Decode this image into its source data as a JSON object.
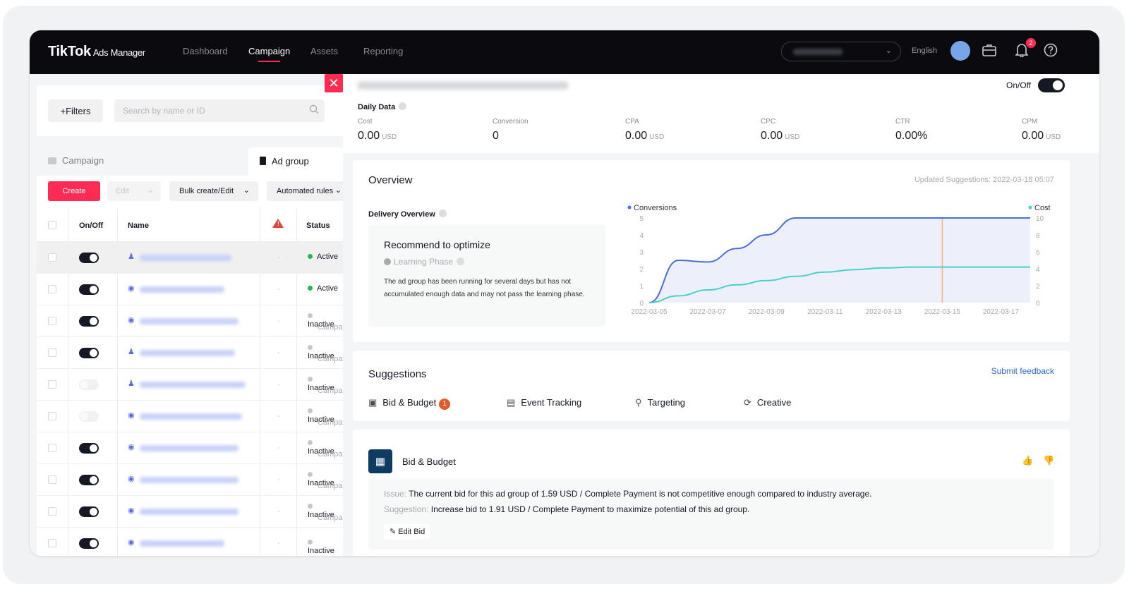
{
  "topbar": {
    "brand": "TikTok",
    "brand_sub": "Ads Manager",
    "nav": [
      "Dashboard",
      "Campaign",
      "Assets",
      "Reporting"
    ],
    "active_nav": "Campaign",
    "language": "English",
    "notification_count": "2"
  },
  "left": {
    "filters_label": "+Filters",
    "search_placeholder": "Search by name or ID",
    "tab_campaign": "Campaign",
    "tab_adgroup": "Ad group",
    "create_label": "Create",
    "edit_label": "Edit",
    "bulk_label": "Bulk create/Edit",
    "rules_label": "Automated rules",
    "columns": {
      "onoff": "On/Off",
      "name": "Name",
      "status": "Status"
    },
    "rows": [
      {
        "on": true,
        "status": "Active",
        "sub": "",
        "dot": "#2bb55a"
      },
      {
        "on": true,
        "status": "Active",
        "sub": "",
        "dot": "#2bb55a"
      },
      {
        "on": true,
        "status": "Inactive",
        "sub": "Campa",
        "dot": "#c6c7cb"
      },
      {
        "on": true,
        "status": "Inactive",
        "sub": "Campa",
        "dot": "#c6c7cb"
      },
      {
        "on": false,
        "status": "Inactive",
        "sub": "Campa",
        "dot": "#c6c7cb"
      },
      {
        "on": false,
        "status": "Inactive",
        "sub": "Campa",
        "dot": "#c6c7cb"
      },
      {
        "on": true,
        "status": "Inactive",
        "sub": "Campa",
        "dot": "#c6c7cb"
      },
      {
        "on": true,
        "status": "Inactive",
        "sub": "Campa",
        "dot": "#c6c7cb"
      },
      {
        "on": true,
        "status": "Inactive",
        "sub": "Campa",
        "dot": "#c6c7cb"
      },
      {
        "on": true,
        "status": "Inactive",
        "sub": "",
        "dot": "#c6c7cb"
      }
    ]
  },
  "detail": {
    "onoff_label": "On/Off",
    "daily_title": "Daily Data",
    "metrics": [
      {
        "label": "Cost",
        "value": "0.00",
        "unit": "USD"
      },
      {
        "label": "Conversion",
        "value": "0",
        "unit": ""
      },
      {
        "label": "CPA",
        "value": "0.00",
        "unit": "USD"
      },
      {
        "label": "CPC",
        "value": "0.00",
        "unit": "USD"
      },
      {
        "label": "CTR",
        "value": "0.00%",
        "unit": ""
      },
      {
        "label": "CPM",
        "value": "0.00",
        "unit": "USD"
      }
    ],
    "overview_title": "Overview",
    "updated": "Updated Suggestions: 2022-03-18 05:07",
    "delivery_overview": "Delivery Overview",
    "rec_title": "Recommend to optimize",
    "learning": "Learning Phase",
    "rec_desc": "The ad group has been running for several days but has not accumulated enough data and may not pass the learning phase.",
    "suggestions_title": "Suggestions",
    "feedback": "Submit feedback",
    "sugg_tabs": [
      "Bid & Budget",
      "Event Tracking",
      "Targeting",
      "Creative"
    ],
    "bid_badge": "1",
    "bb_title": "Bid & Budget",
    "issue_key": "Issue:",
    "issue_text": "The current bid for this ad group of 1.59 USD / Complete Payment is not competitive enough compared to industry average.",
    "sugg_key": "Suggestion:",
    "sugg_text": "Increase bid to 1.91 USD / Complete Payment to maximize potential of this ad group.",
    "edit_bid": "Edit Bid"
  },
  "chart_data": {
    "type": "line",
    "x": [
      "2022-03-05",
      "2022-03-06",
      "2022-03-07",
      "2022-03-08",
      "2022-03-09",
      "2022-03-10",
      "2022-03-11",
      "2022-03-12",
      "2022-03-13",
      "2022-03-14",
      "2022-03-15",
      "2022-03-16",
      "2022-03-17",
      "2022-03-18"
    ],
    "xticks": [
      "2022-03-05",
      "2022-03-07",
      "2022-03-09",
      "2022-03-11",
      "2022-03-13",
      "2022-03-15",
      "2022-03-17"
    ],
    "series": [
      {
        "name": "Conversions",
        "axis": "left",
        "color": "#4a6fdc",
        "values": [
          0,
          2.5,
          2.4,
          3.2,
          4.0,
          5,
          5,
          5,
          5,
          5,
          5,
          5,
          5,
          5
        ]
      },
      {
        "name": "Cost",
        "axis": "right",
        "color": "#4ad0c9",
        "values": [
          0,
          0.8,
          1.5,
          2.1,
          2.6,
          3.1,
          3.6,
          3.9,
          4.1,
          4.2,
          4.2,
          4.2,
          4.2,
          4.2
        ]
      }
    ],
    "ylim_left": [
      0,
      5
    ],
    "yticks_left": [
      0,
      1,
      2,
      3,
      4,
      5
    ],
    "ylim_right": [
      0,
      10
    ],
    "yticks_right": [
      0,
      2,
      4,
      6,
      8,
      10
    ],
    "legend": "top",
    "grid": false
  }
}
